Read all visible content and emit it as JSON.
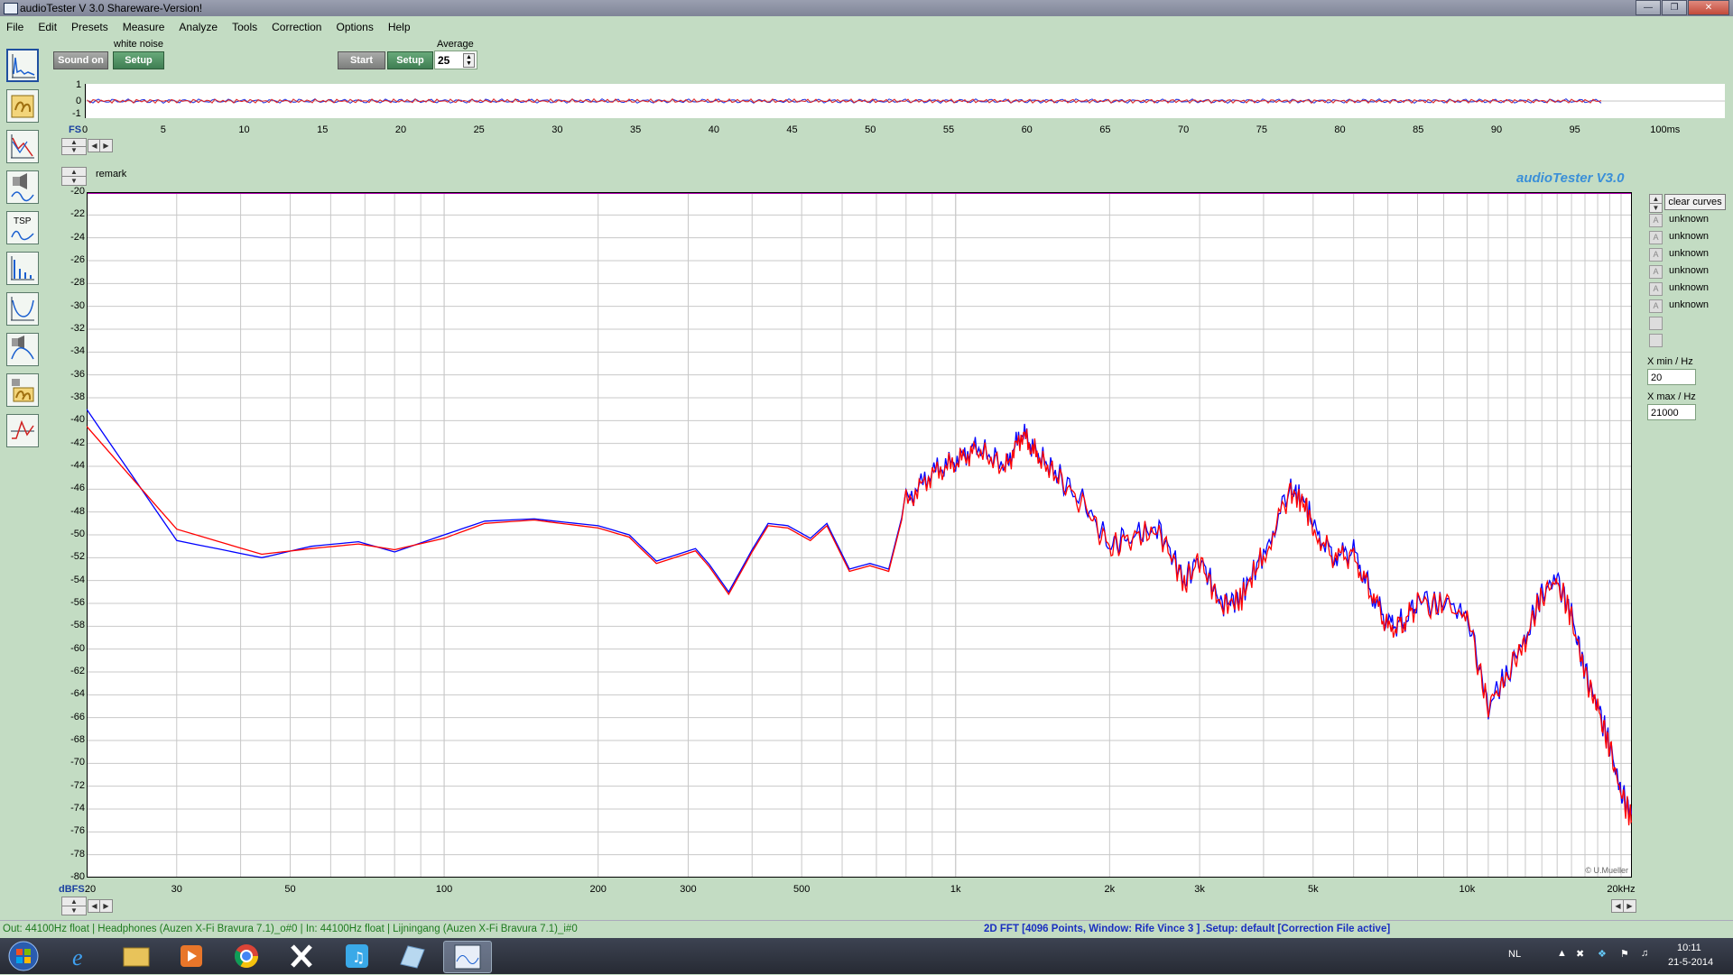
{
  "window": {
    "title": "audioTester  V 3.0 Shareware-Version!"
  },
  "menu": [
    "File",
    "Edit",
    "Presets",
    "Measure",
    "Analyze",
    "Tools",
    "Correction",
    "Options",
    "Help"
  ],
  "toolbar": {
    "noise_label": "white noise",
    "sound_btn": "Sound on",
    "setup1": "Setup",
    "start_btn": "Start",
    "setup2": "Setup",
    "average_label": "Average",
    "average_value": "25"
  },
  "mini_plot": {
    "y_labels": [
      "1",
      "0",
      "-1"
    ],
    "x_prefix": "FS",
    "x_labels": [
      "0",
      "5",
      "10",
      "15",
      "20",
      "25",
      "30",
      "35",
      "40",
      "45",
      "50",
      "55",
      "60",
      "65",
      "70",
      "75",
      "80",
      "85",
      "90",
      "95",
      "100ms"
    ]
  },
  "main": {
    "remark": "remark",
    "brand": "audioTester  V3.0",
    "copyright": "© U.Mueller",
    "y_unit": "dBFS",
    "y_labels": [
      "-20",
      "-22",
      "-24",
      "-26",
      "-28",
      "-30",
      "-32",
      "-34",
      "-36",
      "-38",
      "-40",
      "-42",
      "-44",
      "-46",
      "-48",
      "-50",
      "-52",
      "-54",
      "-56",
      "-58",
      "-60",
      "-62",
      "-64",
      "-66",
      "-68",
      "-70",
      "-72",
      "-74",
      "-76",
      "-78",
      "-80"
    ],
    "x_labels": [
      "20",
      "30",
      "50",
      "100",
      "200",
      "300",
      "500",
      "1k",
      "2k",
      "3k",
      "5k",
      "10k",
      "20kHz"
    ]
  },
  "side": {
    "clear_btn": "clear curves",
    "legend": [
      "unknown",
      "unknown",
      "unknown",
      "unknown",
      "unknown",
      "unknown"
    ],
    "xmin_label": "X min / Hz",
    "xmin_value": "20",
    "xmax_label": "X max / Hz",
    "xmax_value": "21000"
  },
  "status": {
    "left": "Out: 44100Hz float  | Headphones (Auzen X-Fi Bravura 7.1)_o#0  | In: 44100Hz float  | Lijningang (Auzen X-Fi Bravura 7.1)_i#0",
    "right": "2D FFT [4096 Points, Window: Rife Vince 3 ]  .Setup:  default  [Correction File active]"
  },
  "taskbar": {
    "lang": "NL",
    "time": "10:11",
    "date": "21-5-2014"
  },
  "chart_data": {
    "type": "line",
    "xscale": "log",
    "xlim": [
      20,
      21000
    ],
    "ylim": [
      -80,
      -20
    ],
    "xlabel": "",
    "ylabel": "dBFS",
    "series": [
      {
        "color": "#0000ff",
        "x": [
          20,
          30,
          44,
          55,
          68,
          80,
          100,
          120,
          150,
          200,
          230,
          260,
          310,
          330,
          360,
          400,
          430,
          470,
          520,
          560,
          620,
          680,
          740,
          800,
          900,
          1000,
          1100,
          1250,
          1350,
          1450,
          1600,
          1800,
          2000,
          2200,
          2500,
          2800,
          3000,
          3300,
          3600,
          4000,
          4500,
          4800,
          5000,
          5500,
          6000,
          6500,
          7000,
          7500,
          8000,
          9000,
          10000,
          11000,
          12000,
          13000,
          14000,
          15000,
          16000,
          17000,
          18000,
          19000,
          20000,
          21000
        ],
        "y": [
          -39,
          -50.5,
          -52,
          -51,
          -50.6,
          -51.5,
          -50,
          -48.8,
          -48.6,
          -49.2,
          -50,
          -52.3,
          -51.2,
          -52.6,
          -55,
          -51.3,
          -49,
          -49.2,
          -50.3,
          -49,
          -53,
          -52.5,
          -53,
          -47,
          -44.5,
          -43.5,
          -42.3,
          -44,
          -41,
          -43,
          -45,
          -47.5,
          -51,
          -50,
          -49.5,
          -54,
          -52,
          -56,
          -55.5,
          -51.5,
          -46,
          -47,
          -49,
          -52,
          -51.5,
          -55,
          -58,
          -57.5,
          -56,
          -56,
          -57,
          -65,
          -62,
          -59,
          -55,
          -53.8,
          -57,
          -62,
          -65,
          -68.5,
          -72.5,
          -74.5
        ]
      },
      {
        "color": "#ff0000",
        "x": [
          20,
          30,
          44,
          55,
          68,
          80,
          100,
          120,
          150,
          200,
          230,
          260,
          310,
          330,
          360,
          400,
          430,
          470,
          520,
          560,
          620,
          680,
          740,
          800,
          900,
          1000,
          1100,
          1250,
          1350,
          1450,
          1600,
          1800,
          2000,
          2200,
          2500,
          2800,
          3000,
          3300,
          3600,
          4000,
          4500,
          4800,
          5000,
          5500,
          6000,
          6500,
          7000,
          7500,
          8000,
          9000,
          10000,
          11000,
          12000,
          13000,
          14000,
          15000,
          16000,
          17000,
          18000,
          19000,
          20000,
          21000
        ],
        "y": [
          -40.5,
          -49.5,
          -51.7,
          -51.2,
          -50.8,
          -51.3,
          -50.3,
          -49,
          -48.7,
          -49.4,
          -50.2,
          -52.5,
          -51.4,
          -52.8,
          -55.2,
          -51.5,
          -49.2,
          -49.4,
          -50.5,
          -49.2,
          -53.2,
          -52.7,
          -53.2,
          -47.2,
          -44.7,
          -43.7,
          -42.5,
          -44.2,
          -41.2,
          -43.2,
          -45.2,
          -47.7,
          -51.2,
          -50.2,
          -49.7,
          -54.2,
          -52.2,
          -56.2,
          -55.7,
          -51.7,
          -46.2,
          -47.2,
          -49.2,
          -52.2,
          -51.7,
          -55.2,
          -58.2,
          -57.7,
          -56.2,
          -56.2,
          -57.2,
          -65.2,
          -62.2,
          -59.2,
          -55.2,
          -54,
          -57.2,
          -62.2,
          -65.2,
          -68.7,
          -72.7,
          -75
        ]
      }
    ]
  }
}
